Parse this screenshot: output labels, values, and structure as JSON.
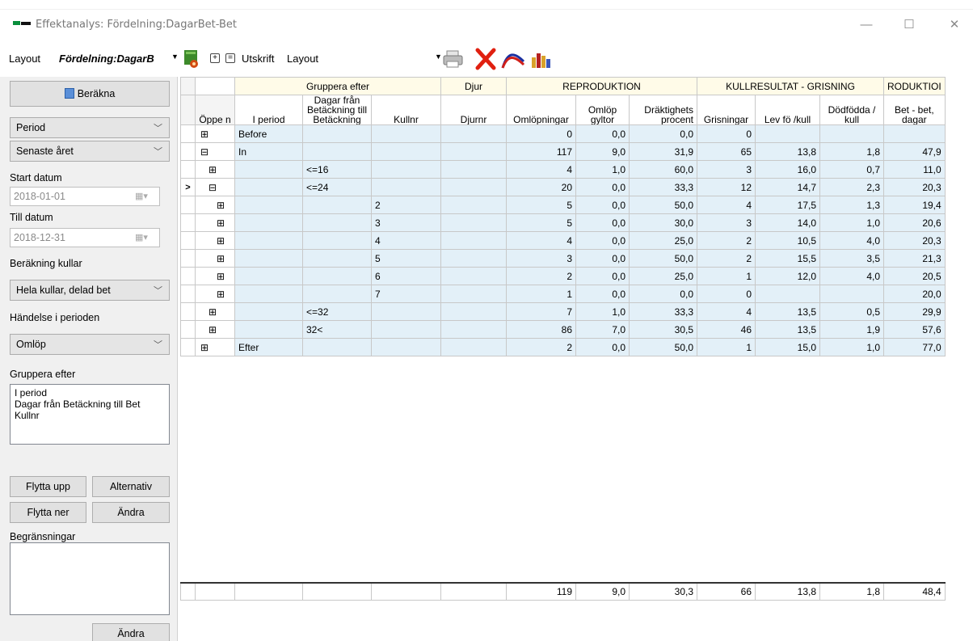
{
  "window": {
    "title": "Effektanalys: Fördelning:DagarBet-Bet",
    "minimize": "—",
    "maximize": "☐",
    "close": "✕"
  },
  "toolbar": {
    "layout_label": "Layout",
    "layout_value": "Fördelning:DagarB",
    "plus_label": "+",
    "minus_label": "=",
    "print_label": "Utskrift",
    "print_layout": "Layout"
  },
  "left": {
    "calculate_button": "Beräkna",
    "period_select": "Period",
    "range_select": "Senaste året",
    "start_label": "Start datum",
    "start_value": "2018-01-01",
    "end_label": "Till datum",
    "end_value": "2018-12-31",
    "litters_label": "Beräkning kullar",
    "litters_select": "Hela kullar, delad bet",
    "event_label": "Händelse i perioden",
    "event_select": "Omlöp",
    "group_label": "Gruppera efter",
    "group_items": [
      "I period",
      "Dagar från Betäckning till Bet",
      "Kullnr"
    ],
    "move_up": "Flytta upp",
    "alternative": "Alternativ",
    "move_down": "Flytta ner",
    "change1": "Ändra",
    "limits_label": "Begränsningar",
    "change2": "Ändra"
  },
  "grid": {
    "group_headers": {
      "gruppera": "Gruppera efter",
      "djur": "Djur",
      "reproduktion": "REPRODUKTION",
      "kullresultat": "KULLRESULTAT - GRISNING",
      "produktion": "RODUKTIOI"
    },
    "columns": {
      "oppen": "Öppe n",
      "iperiod": "I period",
      "dagar": "Dagar från Betäckning till Betäckning",
      "kullnr": "Kullnr",
      "djurnr": "Djurnr",
      "omlopningar": "Omlöpningar",
      "omlopgyltor": "Omlöp gyltor",
      "draktighet": "Dräktighets procent",
      "grisningar": "Grisningar",
      "levfo": "Lev fö /kull",
      "dodfodda": "Dödfödda / kull",
      "betbet": "Bet - bet, dagar"
    },
    "rows": [
      {
        "sel": "",
        "icon": "⊞",
        "indent": 0,
        "iperiod": "Before",
        "dagar": "",
        "kullnr": "",
        "djurnr": "",
        "omlop": "0",
        "gyltor": "0,0",
        "dr": "0,0",
        "gris": "0",
        "lev": "",
        "dod": "",
        "bet": ""
      },
      {
        "sel": "",
        "icon": "⊟",
        "indent": 0,
        "iperiod": "In",
        "dagar": "",
        "kullnr": "",
        "djurnr": "",
        "omlop": "117",
        "gyltor": "9,0",
        "dr": "31,9",
        "gris": "65",
        "lev": "13,8",
        "dod": "1,8",
        "bet": "47,9"
      },
      {
        "sel": "",
        "icon": "⊞",
        "indent": 1,
        "iperiod": "",
        "dagar": "<=16",
        "kullnr": "",
        "djurnr": "",
        "omlop": "4",
        "gyltor": "1,0",
        "dr": "60,0",
        "gris": "3",
        "lev": "16,0",
        "dod": "0,7",
        "bet": "11,0"
      },
      {
        "sel": ">",
        "icon": "⊟",
        "indent": 1,
        "iperiod": "",
        "dagar": "<=24",
        "kullnr": "",
        "djurnr": "",
        "omlop": "20",
        "gyltor": "0,0",
        "dr": "33,3",
        "gris": "12",
        "lev": "14,7",
        "dod": "2,3",
        "bet": "20,3"
      },
      {
        "sel": "",
        "icon": "⊞",
        "indent": 2,
        "iperiod": "",
        "dagar": "",
        "kullnr": "2",
        "djurnr": "",
        "omlop": "5",
        "gyltor": "0,0",
        "dr": "50,0",
        "gris": "4",
        "lev": "17,5",
        "dod": "1,3",
        "bet": "19,4"
      },
      {
        "sel": "",
        "icon": "⊞",
        "indent": 2,
        "iperiod": "",
        "dagar": "",
        "kullnr": "3",
        "djurnr": "",
        "omlop": "5",
        "gyltor": "0,0",
        "dr": "30,0",
        "gris": "3",
        "lev": "14,0",
        "dod": "1,0",
        "bet": "20,6"
      },
      {
        "sel": "",
        "icon": "⊞",
        "indent": 2,
        "iperiod": "",
        "dagar": "",
        "kullnr": "4",
        "djurnr": "",
        "omlop": "4",
        "gyltor": "0,0",
        "dr": "25,0",
        "gris": "2",
        "lev": "10,5",
        "dod": "4,0",
        "bet": "20,3"
      },
      {
        "sel": "",
        "icon": "⊞",
        "indent": 2,
        "iperiod": "",
        "dagar": "",
        "kullnr": "5",
        "djurnr": "",
        "omlop": "3",
        "gyltor": "0,0",
        "dr": "50,0",
        "gris": "2",
        "lev": "15,5",
        "dod": "3,5",
        "bet": "21,3"
      },
      {
        "sel": "",
        "icon": "⊞",
        "indent": 2,
        "iperiod": "",
        "dagar": "",
        "kullnr": "6",
        "djurnr": "",
        "omlop": "2",
        "gyltor": "0,0",
        "dr": "25,0",
        "gris": "1",
        "lev": "12,0",
        "dod": "4,0",
        "bet": "20,5"
      },
      {
        "sel": "",
        "icon": "⊞",
        "indent": 2,
        "iperiod": "",
        "dagar": "",
        "kullnr": "7",
        "djurnr": "",
        "omlop": "1",
        "gyltor": "0,0",
        "dr": "0,0",
        "gris": "0",
        "lev": "",
        "dod": "",
        "bet": "20,0"
      },
      {
        "sel": "",
        "icon": "⊞",
        "indent": 1,
        "iperiod": "",
        "dagar": "<=32",
        "kullnr": "",
        "djurnr": "",
        "omlop": "7",
        "gyltor": "1,0",
        "dr": "33,3",
        "gris": "4",
        "lev": "13,5",
        "dod": "0,5",
        "bet": "29,9"
      },
      {
        "sel": "",
        "icon": "⊞",
        "indent": 1,
        "iperiod": "",
        "dagar": "32<",
        "kullnr": "",
        "djurnr": "",
        "omlop": "86",
        "gyltor": "7,0",
        "dr": "30,5",
        "gris": "46",
        "lev": "13,5",
        "dod": "1,9",
        "bet": "57,6"
      },
      {
        "sel": "",
        "icon": "⊞",
        "indent": 0,
        "iperiod": "Efter",
        "dagar": "",
        "kullnr": "",
        "djurnr": "",
        "omlop": "2",
        "gyltor": "0,0",
        "dr": "50,0",
        "gris": "1",
        "lev": "15,0",
        "dod": "1,0",
        "bet": "77,0"
      }
    ],
    "totals": {
      "omlop": "119",
      "gyltor": "9,0",
      "dr": "30,3",
      "gris": "66",
      "lev": "13,8",
      "dod": "1,8",
      "bet": "48,4"
    }
  }
}
